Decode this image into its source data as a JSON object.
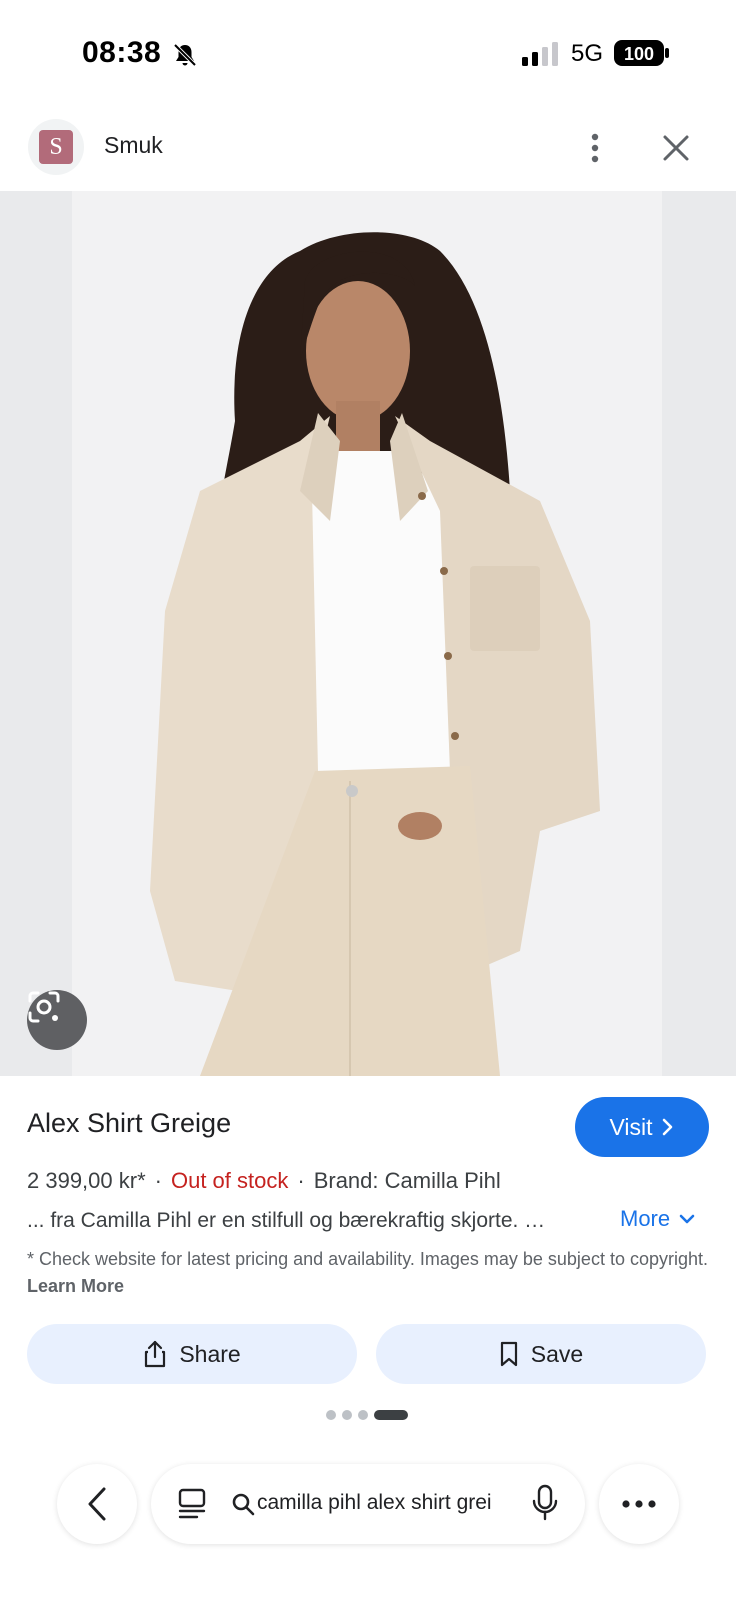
{
  "status_bar": {
    "time": "08:38",
    "network": "5G",
    "battery": "100"
  },
  "header": {
    "site_initial": "S",
    "site_name": "Smuk"
  },
  "product": {
    "title": "Alex Shirt Greige",
    "visit_label": "Visit",
    "price": "2 399,00 kr*",
    "stock": "Out of stock",
    "brand": "Brand: Camilla Pihl",
    "separator": "·",
    "description": "... fra Camilla Pihl er en stilfull og bærekraftig skjorte. …",
    "more_label": "More",
    "disclaimer": "* Check website for latest pricing and availability. Images may be subject to copyright.",
    "learn_more": "Learn More"
  },
  "actions": {
    "share_label": "Share",
    "save_label": "Save"
  },
  "pager": {
    "count": 4,
    "active_index": 3
  },
  "toolbar": {
    "search_query": "camilla pihl alex shirt grei"
  },
  "colors": {
    "accent": "#1a73e8",
    "out_of_stock": "#c5221f",
    "action_bg": "#e8f0fe",
    "site_logo": "#b26b7a"
  },
  "icons": [
    "bell-off-icon",
    "signal-icon",
    "battery-icon",
    "more-vert-icon",
    "close-icon",
    "lens-icon",
    "chevron-right-icon",
    "chevron-down-icon",
    "share-icon",
    "bookmark-icon",
    "back-icon",
    "tabs-icon",
    "search-icon",
    "mic-icon",
    "more-horiz-icon"
  ]
}
